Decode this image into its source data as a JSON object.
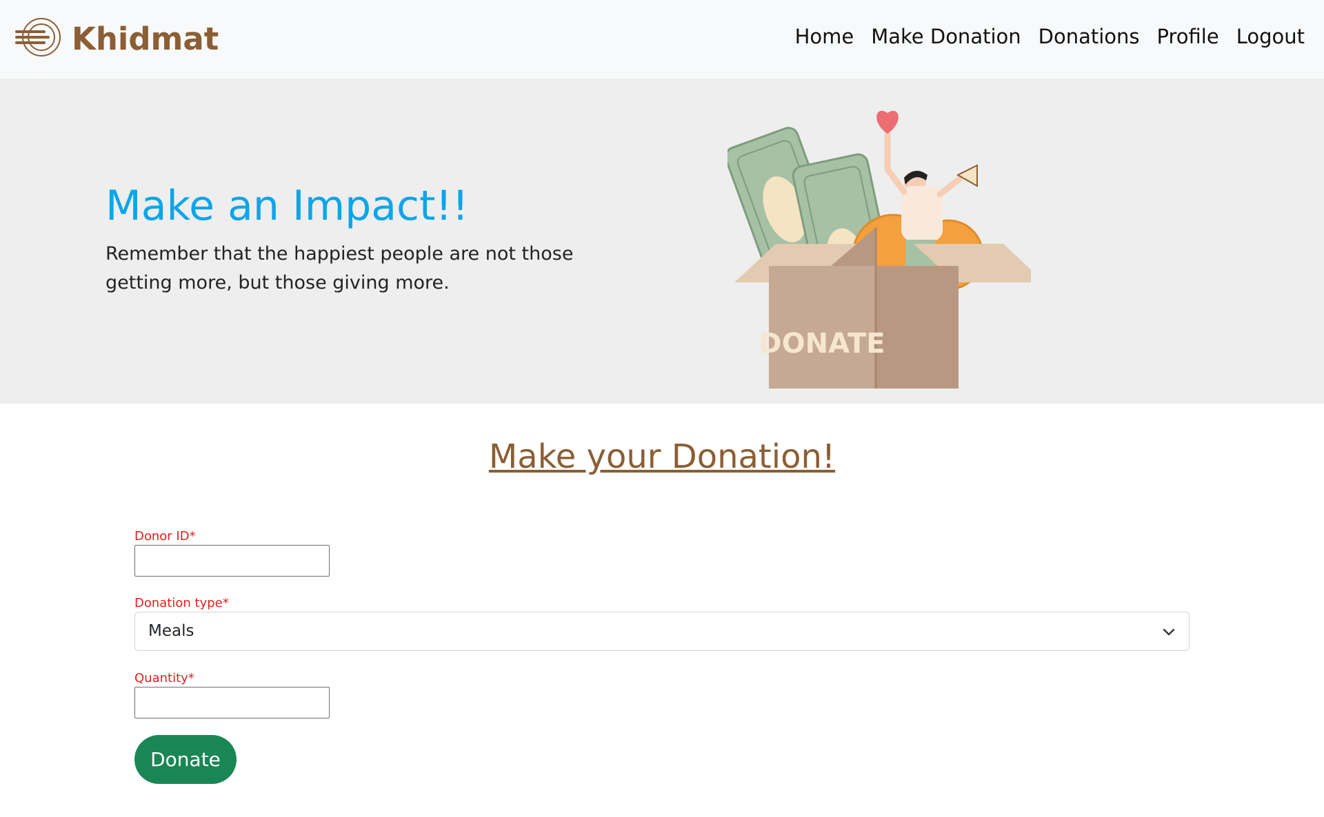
{
  "brand": {
    "name": "Khidmat",
    "logo_icon": "plate-utensils-icon",
    "color": "#8b5e34"
  },
  "nav": {
    "items": [
      {
        "label": "Home"
      },
      {
        "label": "Make Donation"
      },
      {
        "label": "Donations"
      },
      {
        "label": "Profile"
      },
      {
        "label": "Logout"
      }
    ]
  },
  "hero": {
    "title": "Make an Impact!!",
    "text": "Remember that the happiest people are not those getting more, but those giving more.",
    "illustration_text": "DONATE",
    "title_color": "#0aa6e9"
  },
  "form": {
    "title": "Make your Donation!",
    "donor_id": {
      "label": "Donor ID*",
      "value": ""
    },
    "donation_type": {
      "label": "Donation type*",
      "value": "Meals"
    },
    "quantity": {
      "label": "Quantity*",
      "value": ""
    },
    "submit_label": "Donate",
    "button_color": "#198754"
  }
}
